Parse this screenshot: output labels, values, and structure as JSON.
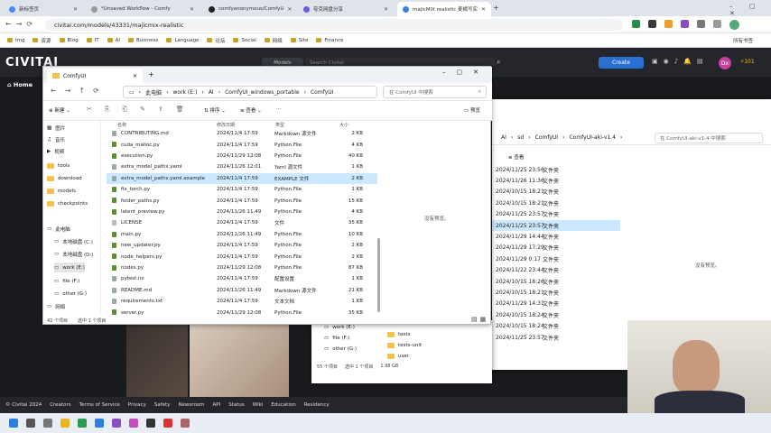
{
  "browser": {
    "tabs": [
      {
        "title": "新标签页",
        "color": "#4a8af4",
        "active": false
      },
      {
        "title": "*Unsaved Workflow - Comfy",
        "color": "#999999",
        "active": false
      },
      {
        "title": "comfyanonymous/ComfyU",
        "color": "#222222",
        "active": false
      },
      {
        "title": "夸克网盘分享",
        "color": "#6b5bd6",
        "active": false
      },
      {
        "title": "majicMIX realistic 麦橘写实",
        "color": "#3b7fe0",
        "active": true
      }
    ],
    "url": "civitai.com/models/43331/majicmix-realistic",
    "bookmarks": [
      "Img",
      "资源",
      "Blog",
      "IT",
      "AI",
      "Business",
      "Language",
      "论坛",
      "Social",
      "网络",
      "Site",
      "Finance"
    ],
    "all_bookmarks": "所有书签"
  },
  "site": {
    "logo": "CIVITAI",
    "nav_models": "Models",
    "search_placeholder": "Search Civitai",
    "create": "Create",
    "avatar": "Dx",
    "buzz": "101",
    "home": "Home",
    "footer": [
      "© Civitai 2024",
      "Creators",
      "Terms of Service",
      "Privacy",
      "Safety",
      "Newsroom",
      "API",
      "Status",
      "Wiki",
      "Education",
      "Residency"
    ]
  },
  "explorer": {
    "tab_title": "ComfyUI",
    "breadcrumb": [
      "此电脑",
      "work (E:)",
      "AI",
      "ComfyUI_windows_portable",
      "ComfyUI"
    ],
    "search_placeholder": "在 ComfyUI 中搜索",
    "toolbar": {
      "new": "新建",
      "sort": "排序",
      "view": "查看",
      "more": "···",
      "preview": "预览"
    },
    "columns": [
      "名称",
      "修改日期",
      "类型",
      "大小"
    ],
    "nav_items": [
      {
        "label": "图片"
      },
      {
        "label": "音乐"
      },
      {
        "label": "视频"
      },
      {
        "label": "tools"
      },
      {
        "label": "download"
      },
      {
        "label": "models"
      },
      {
        "label": "checkpoints"
      },
      {
        "label": "此电脑"
      },
      {
        "label": "本地磁盘 (C:)"
      },
      {
        "label": "本地磁盘 (D:)"
      },
      {
        "label": "work (E:)"
      },
      {
        "label": "file (F:)"
      },
      {
        "label": "other (G:)"
      },
      {
        "label": "网络"
      }
    ],
    "files": [
      {
        "name": "CONTRIBUTING.md",
        "date": "2024/11/4 17:59",
        "type": "Markdown 源文件",
        "size": "2 KB",
        "icon": "txt"
      },
      {
        "name": "cuda_malloc.py",
        "date": "2024/11/4 17:59",
        "type": "Python.File",
        "size": "4 KB",
        "icon": "py"
      },
      {
        "name": "execution.py",
        "date": "2024/11/29 12:08",
        "type": "Python.File",
        "size": "40 KB",
        "icon": "py"
      },
      {
        "name": "extra_model_paths.yaml",
        "date": "2024/11/26 12:01",
        "type": "Yaml 源文件",
        "size": "1 KB",
        "icon": "txt"
      },
      {
        "name": "extra_model_paths.yaml.example",
        "date": "2024/11/4 17:59",
        "type": "EXAMPLE 文件",
        "size": "2 KB",
        "icon": "txt",
        "selected": true
      },
      {
        "name": "fix_torch.py",
        "date": "2024/11/4 17:59",
        "type": "Python.File",
        "size": "1 KB",
        "icon": "py"
      },
      {
        "name": "folder_paths.py",
        "date": "2024/11/4 17:59",
        "type": "Python.File",
        "size": "15 KB",
        "icon": "py"
      },
      {
        "name": "latent_preview.py",
        "date": "2024/11/26 11:49",
        "type": "Python.File",
        "size": "4 KB",
        "icon": "py"
      },
      {
        "name": "LICENSE",
        "date": "2024/11/4 17:59",
        "type": "文件",
        "size": "35 KB",
        "icon": "lic"
      },
      {
        "name": "main.py",
        "date": "2024/11/26 11:49",
        "type": "Python.File",
        "size": "10 KB",
        "icon": "py"
      },
      {
        "name": "new_updater.py",
        "date": "2024/11/4 17:59",
        "type": "Python.File",
        "size": "2 KB",
        "icon": "py"
      },
      {
        "name": "node_helpers.py",
        "date": "2024/11/4 17:59",
        "type": "Python.File",
        "size": "2 KB",
        "icon": "py"
      },
      {
        "name": "nodes.py",
        "date": "2024/11/29 12:08",
        "type": "Python.File",
        "size": "87 KB",
        "icon": "py"
      },
      {
        "name": "pytest.ini",
        "date": "2024/11/4 17:59",
        "type": "配置设置",
        "size": "1 KB",
        "icon": "txt"
      },
      {
        "name": "README.md",
        "date": "2024/11/26 11:49",
        "type": "Markdown 源文件",
        "size": "21 KB",
        "icon": "txt"
      },
      {
        "name": "requirements.txt",
        "date": "2024/11/4 17:59",
        "type": "文本文档",
        "size": "1 KB",
        "icon": "txt"
      },
      {
        "name": "server.py",
        "date": "2024/11/29 12:08",
        "type": "Python.File",
        "size": "35 KB",
        "icon": "py"
      }
    ],
    "no_preview": "没有预览。",
    "status": {
      "count": "42 个项目",
      "selected": "选中 1 个项目"
    }
  },
  "explorer2": {
    "breadcrumb": [
      "AI",
      "sd",
      "ComfyUI",
      "ComfyUI-aki-v1.4"
    ],
    "search_placeholder": "在 ComfyUI-aki-v1.4 中搜索",
    "view": "查看",
    "no_preview": "没有预览。",
    "rows": [
      {
        "date": "2024/11/25 23:56",
        "type": "文件夹"
      },
      {
        "date": "2024/11/26 11:36",
        "type": "文件夹"
      },
      {
        "date": "2024/10/15 18:21",
        "type": "文件夹"
      },
      {
        "date": "2024/10/15 18:21",
        "type": "文件夹"
      },
      {
        "date": "2024/11/25 23:57",
        "type": "文件夹"
      },
      {
        "date": "2024/11/25 23:57",
        "type": "文件夹",
        "selected": true
      },
      {
        "date": "2024/11/29 14:44",
        "type": "文件夹"
      },
      {
        "date": "2024/11/29 17:29",
        "type": "文件夹"
      },
      {
        "date": "2024/11/29 0:17",
        "type": "文件夹"
      },
      {
        "date": "2024/11/22 23:44",
        "type": "文件夹"
      },
      {
        "date": "2024/10/15 18:26",
        "type": "文件夹"
      },
      {
        "date": "2024/10/15 18:21",
        "type": "文件夹"
      },
      {
        "date": "2024/11/29 14:31",
        "type": "文件夹"
      },
      {
        "date": "2024/10/15 18:24",
        "type": "文件夹"
      },
      {
        "date": "2024/10/15 18:24",
        "type": "文件夹"
      },
      {
        "date": "2024/11/25 23:57",
        "type": "文件夹"
      }
    ]
  },
  "explorer3": {
    "items": [
      "work (E:)",
      "file (F:)",
      "other (G:)"
    ],
    "folders": [
      "tests",
      "tests-unit",
      "user"
    ],
    "status": {
      "count": "55 个项目",
      "selected": "选中 1 个项目",
      "size": "1.98 GB"
    }
  }
}
